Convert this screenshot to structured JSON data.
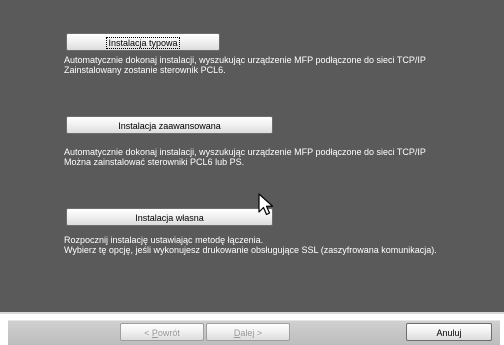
{
  "options": [
    {
      "button_label": "Instalacja typowa",
      "description_line1": "Automatycznie dokonaj instalacji, wyszukując urządzenie MFP podłączone do sieci TCP/IP",
      "description_line2": "Zainstalowany zostanie sterownik PCL6."
    },
    {
      "button_label": "Instalacja zaawansowana",
      "description_line1": "Automatycznie dokonaj instalacji, wyszukując urządzenie MFP podłączone do sieci TCP/IP",
      "description_line2": "Można zainstalować sterowniki PCL6 lub PS."
    },
    {
      "button_label": "Instalacja własna",
      "description_line1": "Rozpocznij instalację ustawiając metodę łączenia.",
      "description_line2": "Wybierz tę opcję, jeśli wykonujesz drukowanie obsługujące SSL (zaszyfrowana komunikacja)."
    }
  ],
  "footer": {
    "back_prefix": "< ",
    "back_mnemonic": "P",
    "back_rest": "owrót",
    "next_mnemonic": "D",
    "next_rest": "alej >",
    "cancel_label": "Anuluj"
  },
  "icons": {
    "cursor": "mouse-pointer-icon"
  },
  "colors": {
    "panel_background": "#5a5a5a",
    "description_text": "#ffffff"
  }
}
